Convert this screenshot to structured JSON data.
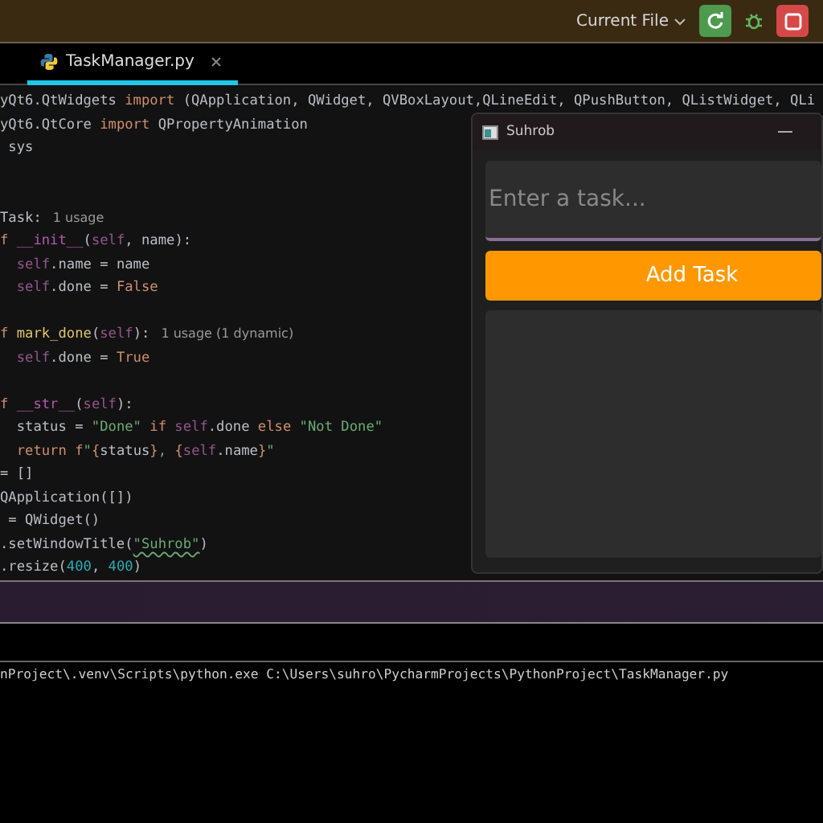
{
  "toolbar": {
    "run_config": "Current File"
  },
  "tabs": [
    {
      "label": "TaskManager.py",
      "selected": true
    }
  ],
  "code_lines": [
    {
      "tokens": [
        {
          "kind": "plain",
          "text": "yQt6.QtWidgets "
        },
        {
          "kind": "keyword",
          "text": "import"
        },
        {
          "kind": "plain",
          "text": " (QApplication, QWidget, QVBoxLayout,QLineEdit, QPushButton, QListWidget, QLi"
        }
      ]
    },
    {
      "tokens": [
        {
          "kind": "plain",
          "text": "yQt6.QtCore "
        },
        {
          "kind": "keyword",
          "text": "import"
        },
        {
          "kind": "plain",
          "text": " QPropertyAnimation"
        }
      ]
    },
    {
      "tokens": [
        {
          "kind": "plain",
          "text": " sys"
        }
      ]
    },
    {
      "kind": "blank"
    },
    {
      "kind": "blank"
    },
    {
      "tokens": [
        {
          "kind": "plain",
          "text": "Task:"
        }
      ],
      "hint": "1 usage"
    },
    {
      "tokens": [
        {
          "kind": "keyword",
          "text": "f"
        },
        {
          "kind": "dunder",
          "text": " __init__"
        },
        {
          "kind": "plain",
          "text": "("
        },
        {
          "kind": "self",
          "text": "self"
        },
        {
          "kind": "plain",
          "text": ", name):"
        }
      ]
    },
    {
      "tokens": [
        {
          "kind": "self",
          "text": "  self"
        },
        {
          "kind": "plain",
          "text": ".name = name"
        }
      ]
    },
    {
      "tokens": [
        {
          "kind": "self",
          "text": "  self"
        },
        {
          "kind": "plain",
          "text": ".done = "
        },
        {
          "kind": "keyword",
          "text": "False"
        }
      ]
    },
    {
      "kind": "blank"
    },
    {
      "tokens": [
        {
          "kind": "keyword",
          "text": "f"
        },
        {
          "kind": "function",
          "text": " mark_done"
        },
        {
          "kind": "plain",
          "text": "("
        },
        {
          "kind": "self",
          "text": "self"
        },
        {
          "kind": "plain",
          "text": "):"
        }
      ],
      "hint": "1 usage (1 dynamic)"
    },
    {
      "tokens": [
        {
          "kind": "self",
          "text": "  self"
        },
        {
          "kind": "plain",
          "text": ".done = "
        },
        {
          "kind": "keyword",
          "text": "True"
        }
      ]
    },
    {
      "kind": "blank"
    },
    {
      "tokens": [
        {
          "kind": "keyword",
          "text": "f"
        },
        {
          "kind": "dunder",
          "text": " __str__"
        },
        {
          "kind": "plain",
          "text": "("
        },
        {
          "kind": "self",
          "text": "self"
        },
        {
          "kind": "plain",
          "text": "):"
        }
      ]
    },
    {
      "tokens": [
        {
          "kind": "plain",
          "text": "  status = "
        },
        {
          "kind": "string",
          "text": "\"Done\""
        },
        {
          "kind": "keyword",
          "text": " if "
        },
        {
          "kind": "self",
          "text": "self"
        },
        {
          "kind": "plain",
          "text": ".done "
        },
        {
          "kind": "keyword",
          "text": "else "
        },
        {
          "kind": "string",
          "text": "\"Not Done\""
        }
      ]
    },
    {
      "tokens": [
        {
          "kind": "keyword",
          "text": "  return f"
        },
        {
          "kind": "string",
          "text": "\""
        },
        {
          "kind": "keyword",
          "text": "{"
        },
        {
          "kind": "plain",
          "text": "status"
        },
        {
          "kind": "keyword",
          "text": "}"
        },
        {
          "kind": "string",
          "text": ", "
        },
        {
          "kind": "keyword",
          "text": "{"
        },
        {
          "kind": "self",
          "text": "self"
        },
        {
          "kind": "plain",
          "text": ".name"
        },
        {
          "kind": "keyword",
          "text": "}"
        },
        {
          "kind": "string",
          "text": "\""
        }
      ]
    },
    {
      "tokens": [
        {
          "kind": "plain",
          "text": "= []"
        }
      ]
    },
    {
      "tokens": [
        {
          "kind": "plain",
          "text": "QApplication([])"
        }
      ]
    },
    {
      "tokens": [
        {
          "kind": "plain",
          "text": " = QWidget()"
        }
      ]
    },
    {
      "tokens": [
        {
          "kind": "plain",
          "text": ".setWindowTitle("
        },
        {
          "kind": "typo_string",
          "text": "\"Suhrob\""
        },
        {
          "kind": "plain",
          "text": ")"
        }
      ]
    },
    {
      "tokens": [
        {
          "kind": "plain",
          "text": ".resize("
        },
        {
          "kind": "number",
          "text": "400"
        },
        {
          "kind": "plain",
          "text": ", "
        },
        {
          "kind": "number",
          "text": "400"
        },
        {
          "kind": "plain",
          "text": ")"
        }
      ]
    }
  ],
  "app_window": {
    "title": "Suhrob",
    "input": {
      "placeholder": "Enter a task..."
    },
    "button": "Add Task"
  },
  "terminal": {
    "lines": [
      "nProject\\.venv\\Scripts\\python.exe C:\\Users\\suhro\\PycharmProjects\\PythonProject\\TaskManager.py"
    ]
  }
}
